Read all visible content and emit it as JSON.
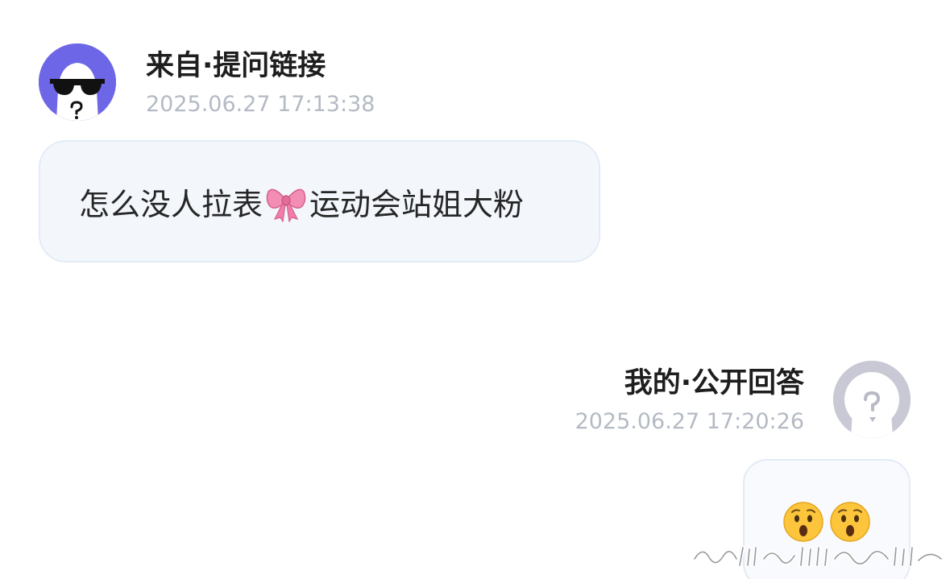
{
  "question": {
    "sender_label": "来自·提问链接",
    "timestamp": "2025.06.27 17:13:38",
    "text_before_emoji": "怎么没人拉表",
    "emoji": "bow-emoji",
    "text_after_emoji": "运动会站姐大粉"
  },
  "answer": {
    "sender_label": "我的·公开回答",
    "timestamp": "2025.06.27 17:20:26",
    "emojis": [
      "hushed-face-emoji",
      "hushed-face-emoji"
    ]
  },
  "colors": {
    "left_avatar_bg": "#6d66e6",
    "right_avatar_bg": "#c8c9d4",
    "bubble_bg": "#f3f7fc",
    "timestamp_text": "#b4bac4"
  }
}
